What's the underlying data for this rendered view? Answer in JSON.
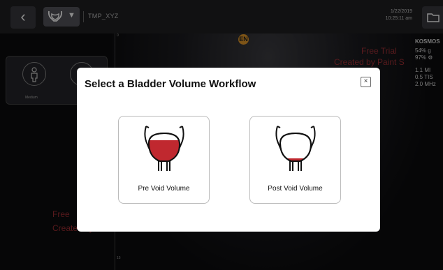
{
  "header": {
    "back_icon": "‹",
    "preset_caret": "▼",
    "patient_id": "TMP_XYZ",
    "date": "1/22/2019",
    "time": "10:25:11 am"
  },
  "mode_panel": {
    "mode_label": "Medium"
  },
  "depth_ticks": [
    "0",
    "15"
  ],
  "orientation_marker": "EN",
  "info": {
    "device": "KOSMOS",
    "line1": "54%  g",
    "line2": "97%  ⚙",
    "line3": "1.1    MI",
    "line4": "0.5  TIS",
    "line5": "2.0 MHz"
  },
  "watermarks": {
    "top_line1": "Free Trial",
    "top_line2": "Created by Paint S",
    "bottom_line1": "Free",
    "bottom_line2": "Created by Paint S"
  },
  "modal": {
    "title": "Select a Bladder Volume Workflow",
    "close_icon": "×",
    "options": [
      {
        "label": "Pre Void Volume",
        "icon": "bladder-full-icon"
      },
      {
        "label": "Post Void Volume",
        "icon": "bladder-empty-icon"
      }
    ]
  },
  "colors": {
    "fill_red": "#c0282f",
    "orientation_marker": "#e39a2a"
  }
}
